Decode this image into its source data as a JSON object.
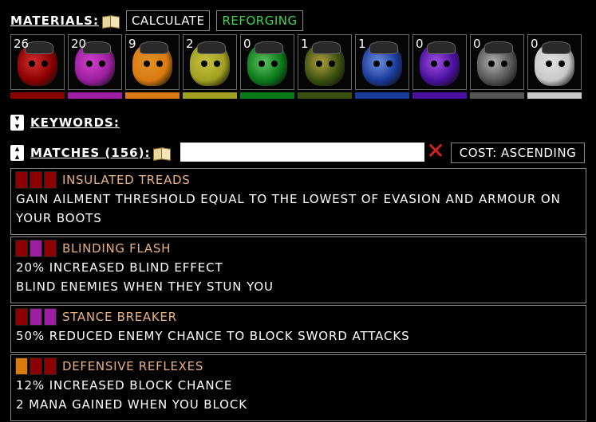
{
  "toolbar": {
    "materials_label": "MATERIALS:",
    "calculate_label": "CALCULATE",
    "reforging_label": "REFORGING"
  },
  "materials": [
    {
      "count": "26",
      "color": "#8b0000",
      "tint": "#d03030"
    },
    {
      "count": "20",
      "color": "#9b1fa0",
      "tint": "#d040c8"
    },
    {
      "count": "9",
      "color": "#d97a10",
      "tint": "#e0902a"
    },
    {
      "count": "2",
      "color": "#a0a020",
      "tint": "#c8c040"
    },
    {
      "count": "0",
      "color": "#0a7a1a",
      "tint": "#60c060"
    },
    {
      "count": "1",
      "color": "#3a5010",
      "tint": "#b0a040"
    },
    {
      "count": "1",
      "color": "#1a3a9a",
      "tint": "#7090e0"
    },
    {
      "count": "0",
      "color": "#4a10a0",
      "tint": "#a050e0"
    },
    {
      "count": "0",
      "color": "#555555",
      "tint": "#b0b0b0"
    },
    {
      "count": "0",
      "color": "#c8c8c8",
      "tint": "#e0e0e0"
    }
  ],
  "keywords": {
    "label": "KEYWORDS:"
  },
  "matches": {
    "label": "MATCHES (156):",
    "search_value": "",
    "sort_label": "COST: ASCENDING"
  },
  "results": [
    {
      "name": "INSULATED TREADS",
      "slots": [
        "#8b0000",
        "#8b0000",
        "#8b0000"
      ],
      "lines": [
        "GAIN AILMENT THRESHOLD EQUAL TO THE LOWEST OF EVASION AND ARMOUR ON",
        "YOUR BOOTS"
      ]
    },
    {
      "name": "BLINDING FLASH",
      "slots": [
        "#8b0000",
        "#9b1fa0",
        "#8b0000"
      ],
      "lines": [
        "20% INCREASED BLIND EFFECT",
        "BLIND ENEMIES WHEN THEY STUN YOU"
      ]
    },
    {
      "name": "STANCE BREAKER",
      "slots": [
        "#8b0000",
        "#9b1fa0",
        "#9b1fa0"
      ],
      "lines": [
        "50% REDUCED ENEMY CHANCE TO BLOCK SWORD ATTACKS"
      ]
    },
    {
      "name": "DEFENSIVE REFLEXES",
      "slots": [
        "#d97a10",
        "#8b0000",
        "#8b0000"
      ],
      "lines": [
        "12% INCREASED BLOCK CHANCE",
        "2 MANA GAINED WHEN YOU BLOCK"
      ]
    }
  ]
}
